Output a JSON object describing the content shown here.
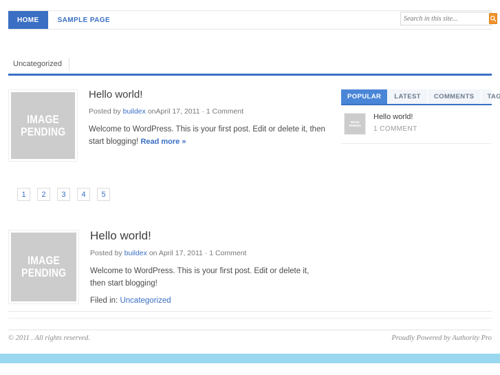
{
  "header": {
    "nav": [
      {
        "label": "HOME",
        "active": true
      },
      {
        "label": "SAMPLE PAGE",
        "active": false
      }
    ],
    "search": {
      "placeholder": "Search in this site...",
      "value": "",
      "button_icon": "search-icon"
    }
  },
  "breadcrumb": {
    "category": "Uncategorized"
  },
  "posts": [
    {
      "title": "Hello world!",
      "meta_prefix": "Posted by",
      "author": "buildex",
      "meta_mid": " on",
      "date": "April 17, 2011",
      "meta_sep": " · ",
      "comments": "1 Comment",
      "excerpt": "Welcome to WordPress. This is your first post. Edit or delete it, then start blogging! ",
      "read_more": "Read more »",
      "thumb_line1": "IMAGE",
      "thumb_line2": "PENDING"
    },
    {
      "title": "Hello world!",
      "meta_prefix": "Posted by",
      "author": "buildex",
      "meta_mid": " on ",
      "date": "April 17, 2011",
      "meta_sep": " · ",
      "comments": "1 Comment",
      "excerpt": "Welcome to WordPress. This is your first post. Edit or delete it, then start blogging!",
      "filed_label": "Filed in: ",
      "filed_category": "Uncategorized",
      "thumb_line1": "IMAGE",
      "thumb_line2": "PENDING"
    }
  ],
  "pagination": {
    "pages": [
      "1",
      "2",
      "3",
      "4",
      "5"
    ]
  },
  "sidebar": {
    "tabs": [
      {
        "label": "POPULAR",
        "active": true
      },
      {
        "label": "LATEST",
        "active": false
      },
      {
        "label": "COMMENTS",
        "active": false
      },
      {
        "label": "TAGS",
        "active": false
      }
    ],
    "items": [
      {
        "title": "Hello world!",
        "subtitle": "1 COMMENT",
        "thumb_line1": "IMAGE",
        "thumb_line2": "PENDING"
      }
    ]
  },
  "footer": {
    "copyright": "© 2011 . All rights reserved.",
    "credit": "Proudly Powered by Authority Pro"
  },
  "colors": {
    "brand_blue": "#3a6fc4",
    "tab_blue": "#4a86d8",
    "accent_orange": "#f0922b",
    "band_blue": "#9ad8f0",
    "placeholder_gray": "#cccccc"
  }
}
